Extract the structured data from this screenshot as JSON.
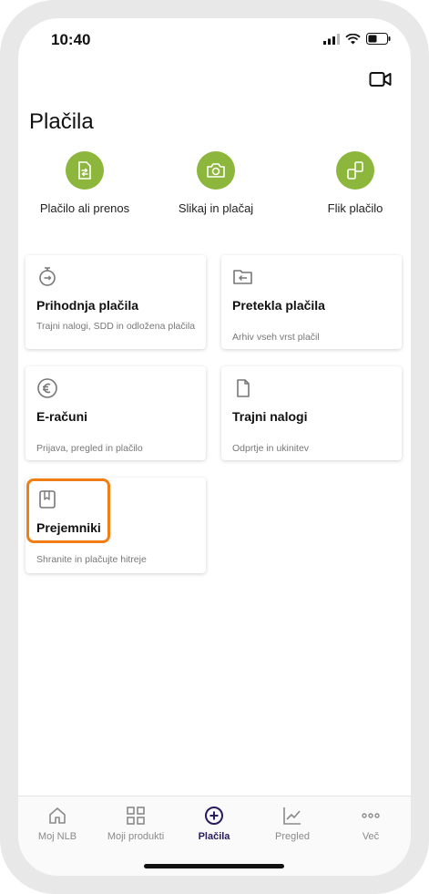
{
  "status_bar": {
    "time": "10:40"
  },
  "page": {
    "title": "Plačila"
  },
  "quick_actions": [
    {
      "label": "Plačilo ali prenos",
      "icon": "transfer-document-icon"
    },
    {
      "label": "Slikaj in plačaj",
      "icon": "camera-icon"
    },
    {
      "label": "Flik plačilo",
      "icon": "flik-icon"
    }
  ],
  "cards": [
    {
      "title": "Prihodnja plačila",
      "subtitle": "Trajni nalogi, SDD in odložena plačila",
      "icon": "timer-icon"
    },
    {
      "title": "Pretekla plačila",
      "subtitle": "Arhiv vseh vrst plačil",
      "icon": "folder-arrow-icon"
    },
    {
      "title": "E-računi",
      "subtitle": "Prijava, pregled in plačilo",
      "icon": "euro-icon"
    },
    {
      "title": "Trajni nalogi",
      "subtitle": "Odprtje in ukinitev",
      "icon": "document-icon"
    },
    {
      "title": "Prejemniki",
      "subtitle": "Shranite in plačujte hitreje",
      "icon": "bookmark-icon"
    }
  ],
  "tabs": [
    {
      "label": "Moj NLB",
      "icon": "home-icon",
      "active": false
    },
    {
      "label": "Moji produkti",
      "icon": "grid-icon",
      "active": false
    },
    {
      "label": "Plačila",
      "icon": "plus-circle-icon",
      "active": true
    },
    {
      "label": "Pregled",
      "icon": "chart-icon",
      "active": false
    },
    {
      "label": "Več",
      "icon": "more-icon",
      "active": false
    }
  ],
  "colors": {
    "accent_green": "#8cb63c",
    "highlight_orange": "#f07e14",
    "active_tab": "#2a1a5e"
  }
}
